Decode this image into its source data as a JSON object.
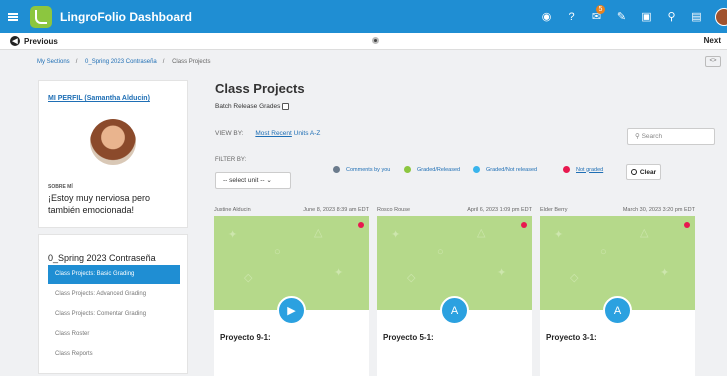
{
  "header": {
    "title": "LingroFolio Dashboard",
    "notification_count": "5"
  },
  "nav": {
    "previous": "Previous",
    "next": "Next"
  },
  "breadcrumb": [
    "My Sections",
    "0_Spring 2023 Contraseña",
    "Class Projects"
  ],
  "profile": {
    "link": "MI PERFIL (Samantha Alducin)",
    "about_label": "SOBRE MÍ",
    "about_text": "¡Estoy muy nerviosa pero también emocionada!"
  },
  "section": {
    "title": "0_Spring 2023 Contraseña",
    "items": [
      "Class Projects: Basic Grading",
      "Class Projects: Advanced Grading",
      "Class Projects: Comentar Grading",
      "Class Roster",
      "Class Reports"
    ]
  },
  "main": {
    "title": "Class Projects",
    "batch_label": "Batch Release Grades",
    "view_by_label": "VIEW BY:",
    "view_options": [
      "Most Recent",
      "Units A-Z"
    ],
    "search_placeholder": "Search",
    "filter_by_label": "FILTER BY:",
    "select_value": "-- select unit --",
    "legend": [
      {
        "label": "Comments by you",
        "color": "#6b7b8c"
      },
      {
        "label": "Graded/Released",
        "color": "#8cc63f"
      },
      {
        "label": "Graded/Not released",
        "color": "#39b4ec"
      },
      {
        "label": "Not graded",
        "color": "#e8194f"
      }
    ],
    "clear_label": "Clear"
  },
  "cards": [
    {
      "author": "Justine Alducin",
      "date": "June 8, 2023 8:39 am EDT",
      "title": "Proyecto 9-1:",
      "icon": "video-icon"
    },
    {
      "author": "Rosco Rouse",
      "date": "April 6, 2023 1:09 pm EDT",
      "title": "Proyecto 5-1:",
      "icon": "text-icon"
    },
    {
      "author": "Elder Berry",
      "date": "March 30, 2023 3:20 pm EDT",
      "title": "Proyecto 3-1:",
      "icon": "text-icon"
    }
  ]
}
